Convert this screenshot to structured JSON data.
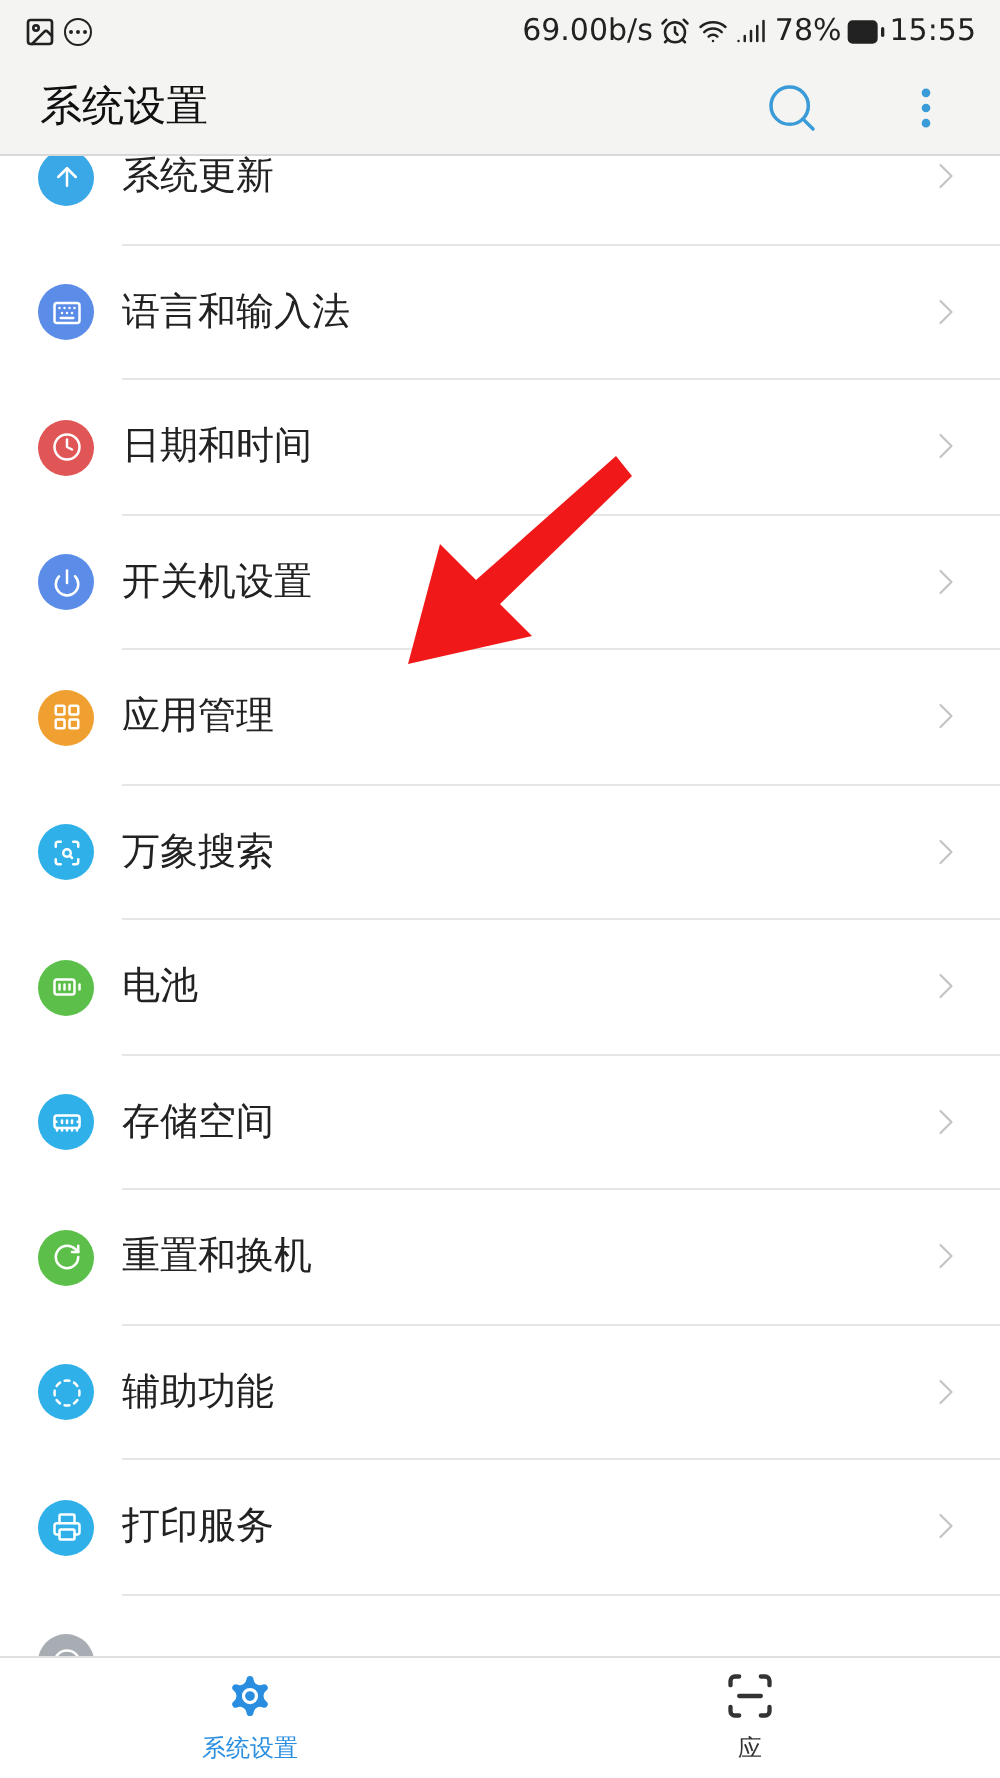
{
  "status_bar": {
    "speed": "69.00b/s",
    "battery": "78%",
    "time": "15:55"
  },
  "header": {
    "title": "系统设置"
  },
  "items": [
    {
      "label": "系统更新",
      "color": "#3aa8e6"
    },
    {
      "label": "语言和输入法",
      "color": "#5b8de8"
    },
    {
      "label": "日期和时间",
      "color": "#e05555"
    },
    {
      "label": "开关机设置",
      "color": "#5b8de8"
    },
    {
      "label": "应用管理",
      "color": "#f0a030"
    },
    {
      "label": "万象搜索",
      "color": "#2fb0e8"
    },
    {
      "label": "电池",
      "color": "#5cbf4a"
    },
    {
      "label": "存储空间",
      "color": "#2fb0e8"
    },
    {
      "label": "重置和换机",
      "color": "#5cbf4a"
    },
    {
      "label": "辅助功能",
      "color": "#2fb0e8"
    },
    {
      "label": "打印服务",
      "color": "#2fb0e8"
    },
    {
      "color": "#a8adb3"
    }
  ],
  "bottom_nav": [
    {
      "label": "系统设置",
      "selected": true
    },
    {
      "label": "应",
      "selected": false
    }
  ]
}
